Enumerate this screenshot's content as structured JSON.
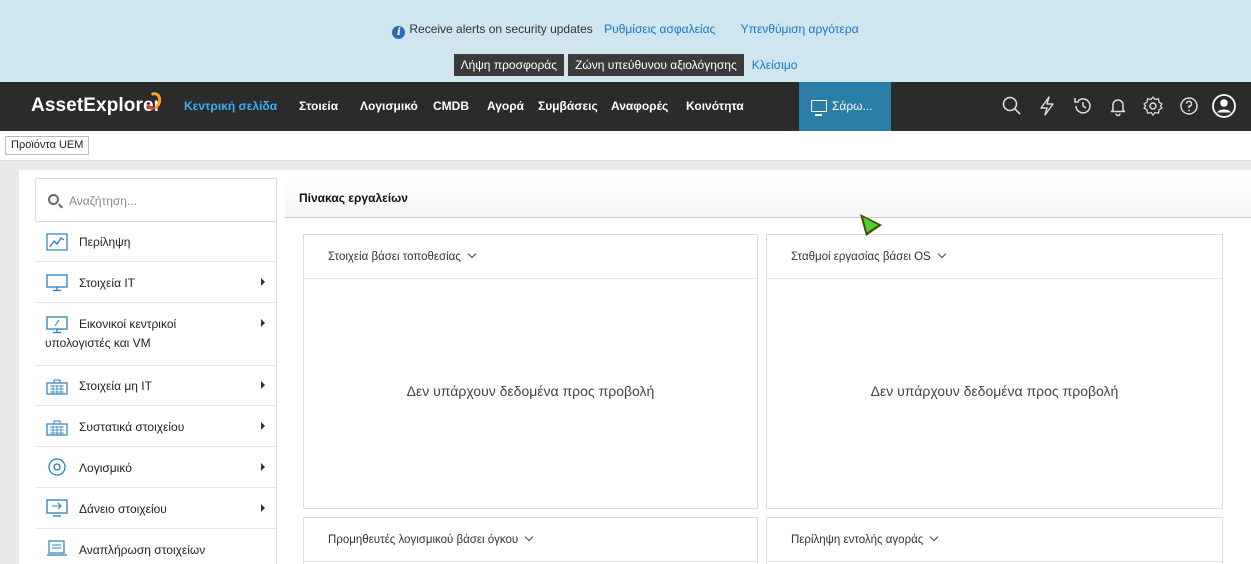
{
  "banner": {
    "message": "Receive alerts on security updates",
    "settings_link": "Ρυθμίσεις ασφαλείας",
    "remind_link": "Υπενθύμιση αργότερα",
    "offer_button": "Λήψη προσφοράς",
    "zone_button": "Ζώνη υπεύθυνου αξιολόγησης",
    "close_link": "Κλείσιμο"
  },
  "nav": {
    "logo": "AssetExplorer",
    "items": [
      "Κεντρική σελίδα",
      "Στοιεία",
      "Λογισμικό",
      "CMDB",
      "Αγορά",
      "Συμβάσεις",
      "Αναφορές",
      "Κοινότητα"
    ],
    "scan_label": "Σάρω...",
    "active_color": "#3ab0f0",
    "icons": [
      "search-icon",
      "lightning-icon",
      "history-icon",
      "bell-icon",
      "gear-icon",
      "help-icon",
      "user-icon"
    ]
  },
  "subbar": {
    "uem_button": "Προϊόντα UEM"
  },
  "sidebar": {
    "search_placeholder": "Αναζήτηση...",
    "items": [
      {
        "label": "Περίληψη",
        "icon": "chart-icon"
      },
      {
        "label": "Στοιχεία IT",
        "icon": "monitor-icon"
      },
      {
        "label": "Εικονικοί κεντρικοί",
        "label2": "υπολογιστές και VM",
        "icon": "virtual-monitor-icon"
      },
      {
        "label": "Στοιχεία μη IT",
        "icon": "keyboard-icon"
      },
      {
        "label": "Συστατικά στοιχείου",
        "icon": "keyboard-icon"
      },
      {
        "label": "Λογισμικό",
        "icon": "disc-icon"
      },
      {
        "label": "Δάνειο στοιχείου",
        "icon": "loan-icon"
      },
      {
        "label": "Αναπλήρωση στοιχείων",
        "icon": "replenish-icon"
      }
    ]
  },
  "dashboard": {
    "title": "Πίνακας εργαλείων",
    "widgets": [
      {
        "title": "Στοιχεία βάσει τοποθεσίας",
        "empty": "Δεν υπάρχουν δεδομένα προς προβολή"
      },
      {
        "title": "Σταθμοί εργασίας βάσει OS",
        "empty": "Δεν υπάρχουν δεδομένα προς προβολή"
      },
      {
        "title": "Προμηθευτές λογισμικού βάσει όγκου"
      },
      {
        "title": "Περίληψη εντολής αγοράς"
      }
    ]
  }
}
